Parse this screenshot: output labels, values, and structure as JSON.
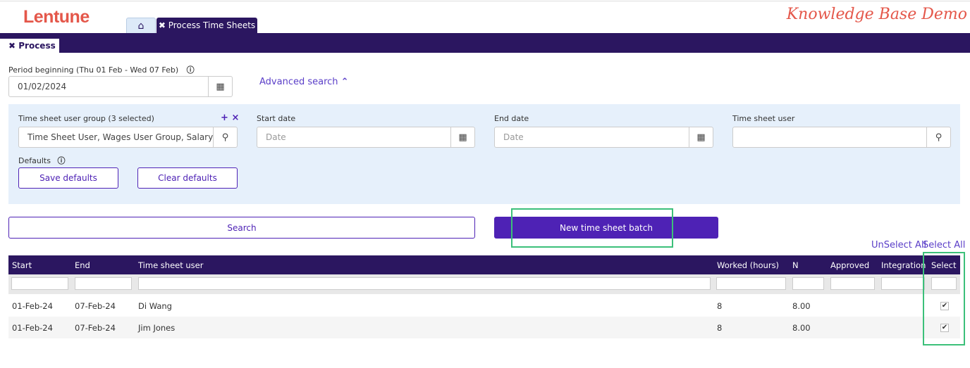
{
  "header": {
    "logo": "Lentune",
    "demo_label": "Knowledge Base Demo"
  },
  "tabs": {
    "home_icon": "home-icon",
    "active_tab": "✖ Process Time Sheets"
  },
  "subtab": {
    "label": "✖ Process"
  },
  "period": {
    "label": "Period beginning (Thu 01 Feb - Wed 07 Feb)",
    "value": "01/02/2024"
  },
  "advanced_search": {
    "label": "Advanced search",
    "icon": "chevron-up-icon"
  },
  "filters": {
    "user_group": {
      "label": "Time sheet user group (3 selected)",
      "value": "Time Sheet User, Wages User Group, Salary"
    },
    "start_date": {
      "label": "Start date",
      "placeholder": "Date"
    },
    "end_date": {
      "label": "End date",
      "placeholder": "Date"
    },
    "user": {
      "label": "Time sheet user",
      "value": ""
    },
    "defaults_label": "Defaults",
    "save_defaults": "Save defaults",
    "clear_defaults": "Clear defaults"
  },
  "actions": {
    "search": "Search",
    "new_batch": "New time sheet batch",
    "unselect_all": "UnSelect All",
    "select_all": "Select All"
  },
  "table": {
    "columns": [
      "Start",
      "End",
      "Time sheet user",
      "Worked (hours)",
      "N",
      "Approved",
      "Integration",
      "Select"
    ],
    "rows": [
      {
        "start": "01-Feb-24",
        "end": "07-Feb-24",
        "user": "Di Wang",
        "worked": "8",
        "n": "8.00",
        "approved": "",
        "integration": "",
        "selected": true
      },
      {
        "start": "01-Feb-24",
        "end": "07-Feb-24",
        "user": "Jim Jones",
        "worked": "8",
        "n": "8.00",
        "approved": "",
        "integration": "",
        "selected": true
      }
    ]
  },
  "colors": {
    "brand": "#e4574a",
    "primary": "#2b1660",
    "button": "#4e22b5",
    "highlight": "#3cc07a",
    "panel": "#e6f0fb"
  }
}
